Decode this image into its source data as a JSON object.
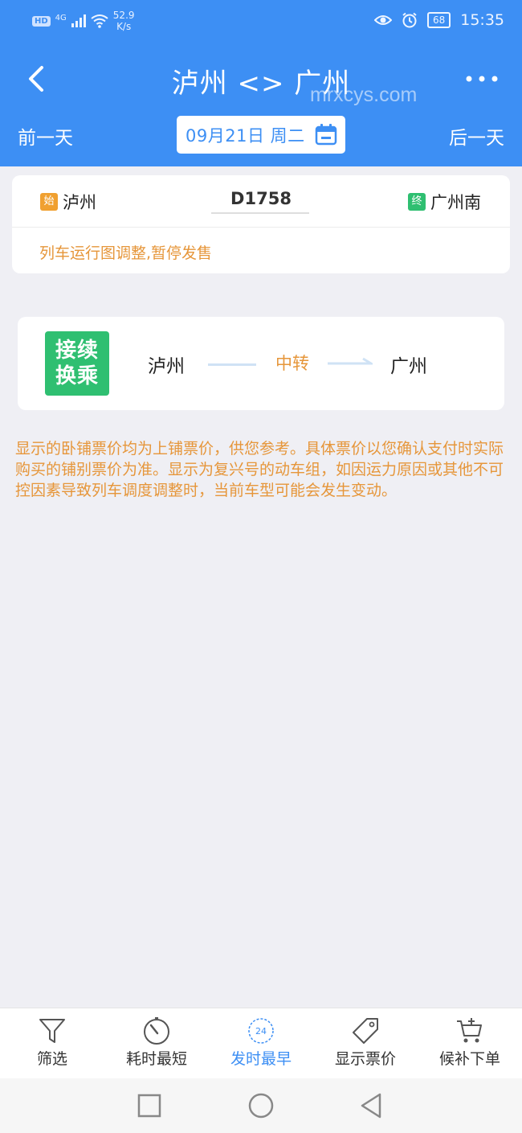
{
  "status_bar": {
    "hd": "HD",
    "network": "4G",
    "speed_value": "52.9",
    "speed_unit": "K/s",
    "battery": "68",
    "time": "15:35"
  },
  "header": {
    "title": "泸州 <> 广州",
    "watermark": "mrxcys.com",
    "prev_day": "前一天",
    "next_day": "后一天",
    "date": "09月21日 周二"
  },
  "train": {
    "from_tag": "始",
    "from": "泸州",
    "number": "D1758",
    "to_tag": "终",
    "to": "广州南",
    "notice": "列车运行图调整,暂停发售"
  },
  "transfer": {
    "badge_line1": "接续",
    "badge_line2": "换乘",
    "from": "泸州",
    "middle": "中转",
    "to": "广州"
  },
  "disclaimer": "显示的卧铺票价均为上铺票价，供您参考。具体票价以您确认支付时实际购买的铺别票价为准。显示为复兴号的动车组，如因运力原因或其他不可控因素导致列车调度调整时，当前车型可能会发生变动。",
  "tabs": [
    {
      "label": "筛选",
      "icon": "filter-icon"
    },
    {
      "label": "耗时最短",
      "icon": "timer-icon"
    },
    {
      "label": "发时最早",
      "icon": "clock-24-icon",
      "active": true,
      "icon_text": "24"
    },
    {
      "label": "显示票价",
      "icon": "price-tag-icon"
    },
    {
      "label": "候补下单",
      "icon": "cart-add-icon"
    }
  ],
  "colors": {
    "primary": "#3d8ff4",
    "warning": "#e6963a",
    "success": "#2fbf71",
    "background": "#efeff4"
  }
}
